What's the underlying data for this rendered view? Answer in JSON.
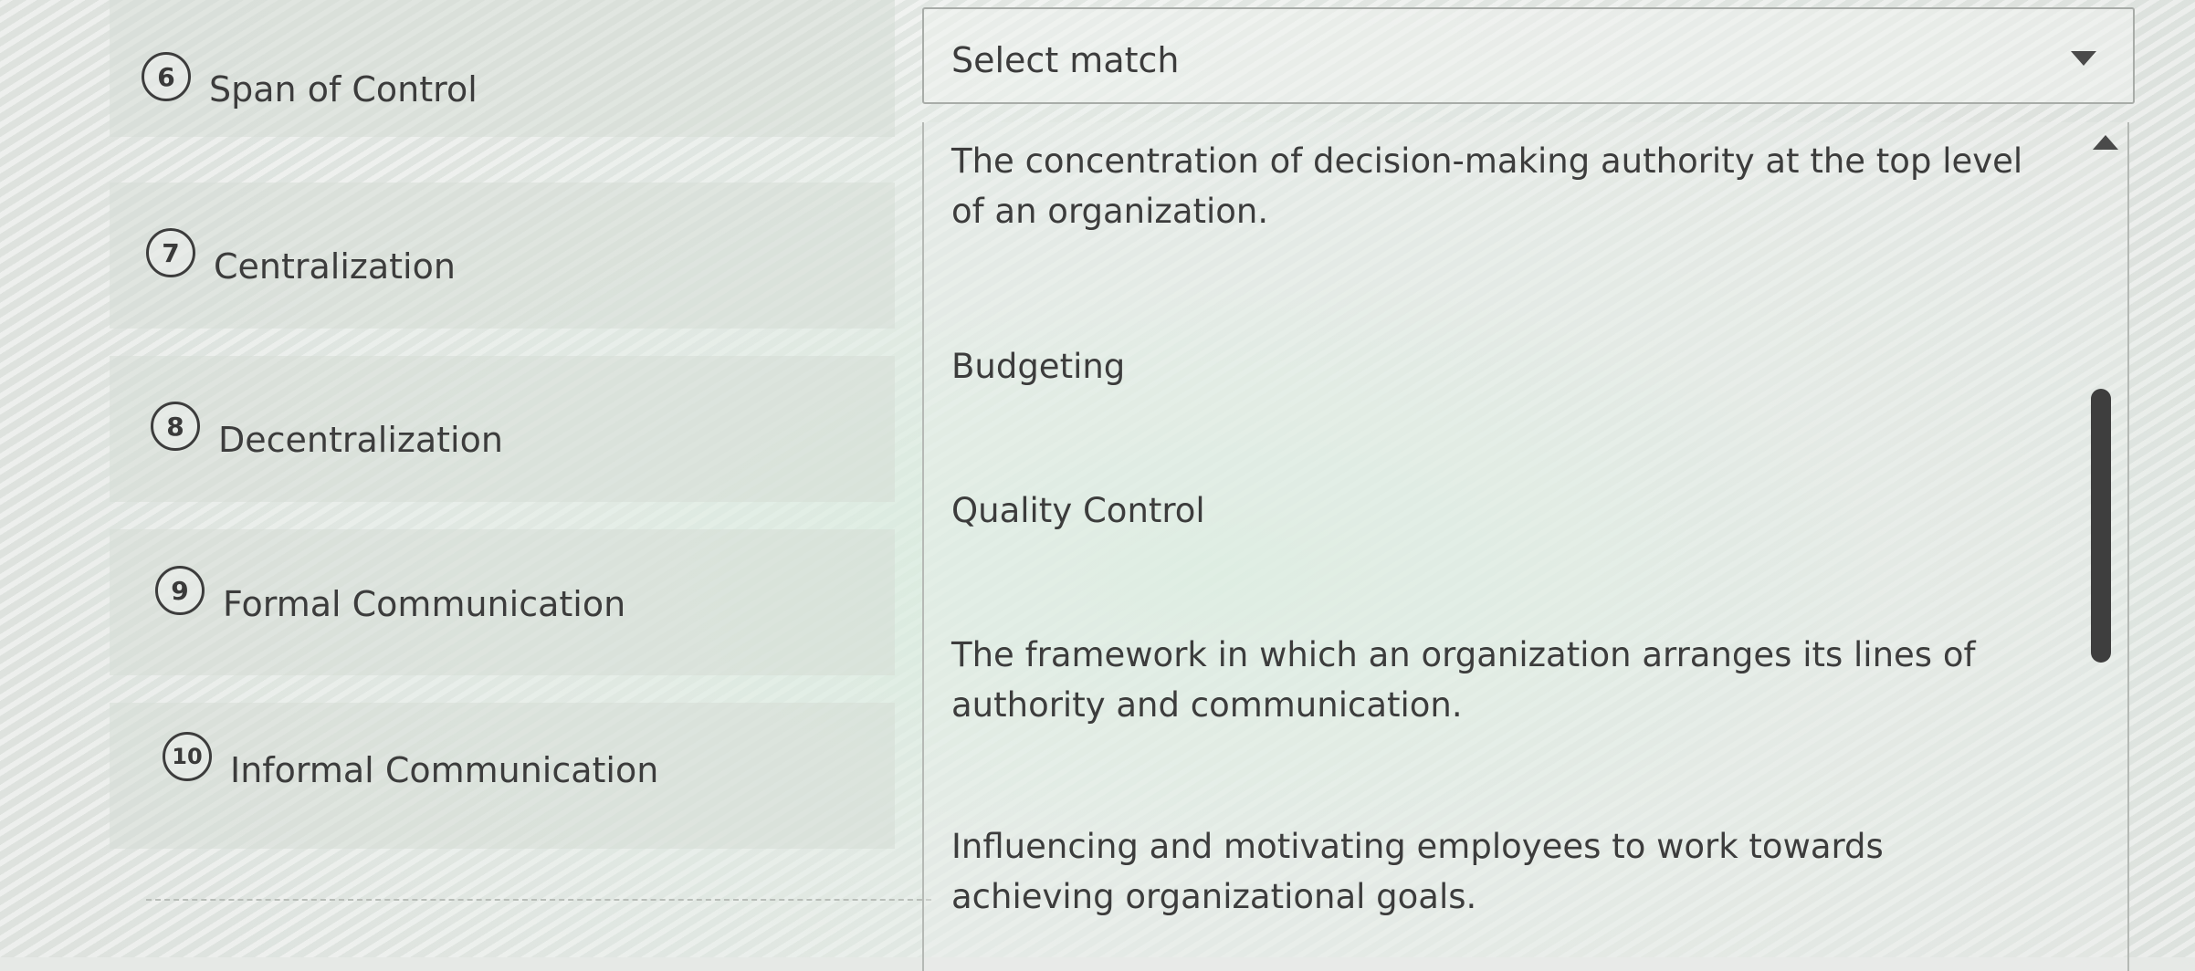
{
  "left_items": [
    {
      "number": "6",
      "label": "Span of Control"
    },
    {
      "number": "7",
      "label": "Centralization"
    },
    {
      "number": "8",
      "label": "Decentralization"
    },
    {
      "number": "9",
      "label": "Formal Communication"
    },
    {
      "number": "10",
      "label": "Informal Communication"
    }
  ],
  "select": {
    "value": "Select match",
    "caret_icon": "caret-down-icon"
  },
  "dropdown": {
    "options": [
      "The concentration of decision-making authority at the top level of an organization.",
      "Budgeting",
      "Quality Control",
      "The framework in which an organization arranges its lines of authority and communication.",
      "Influencing and motivating employees to work towards achieving organizational goals."
    ],
    "scroll_up_icon": "caret-up-icon"
  },
  "colors": {
    "text": "#3c3c3c",
    "scrollbar": "#3e3e3e",
    "border": "#a8aca8"
  }
}
